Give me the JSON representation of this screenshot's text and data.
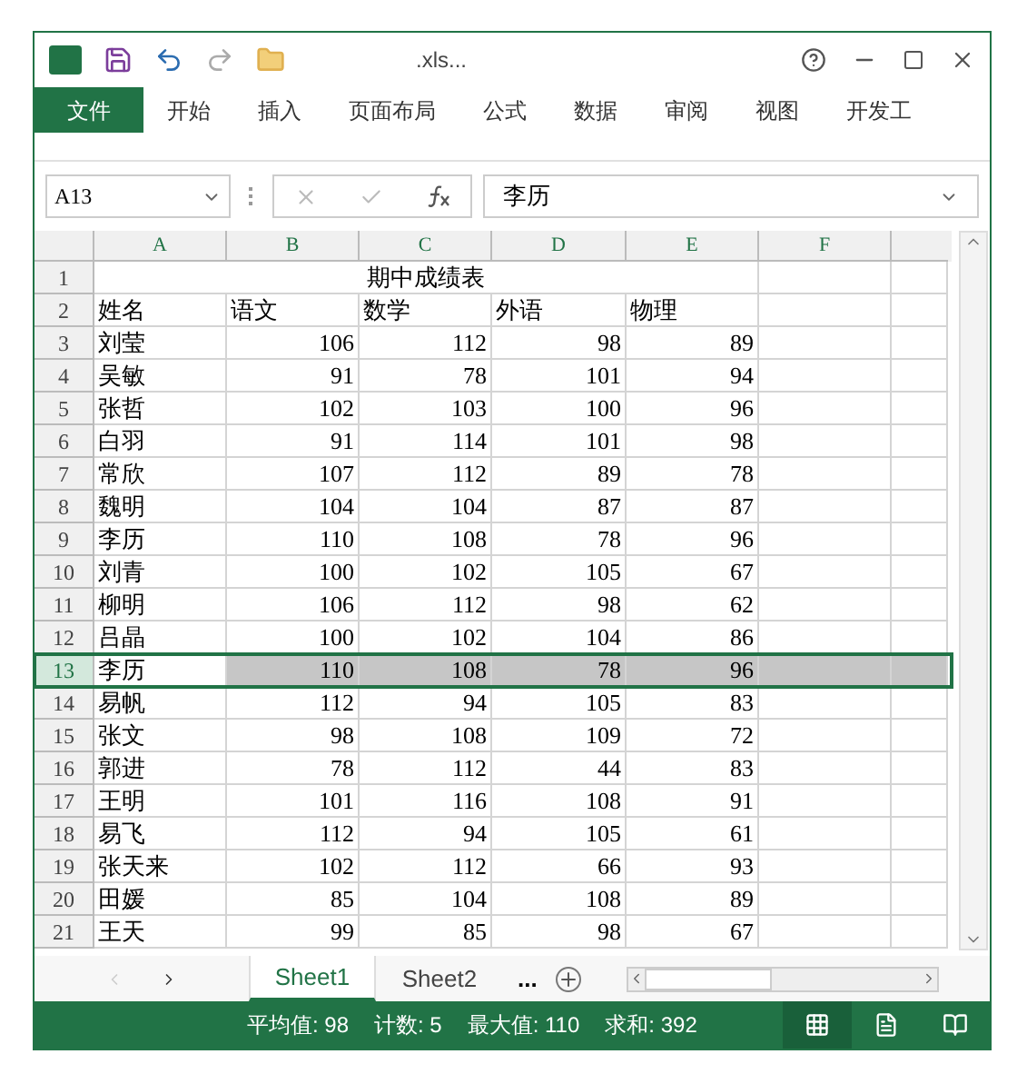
{
  "window": {
    "title": ".xls..."
  },
  "ribbon_tabs": [
    {
      "label": "文件",
      "kind": "file"
    },
    {
      "label": "开始",
      "kind": "tab"
    },
    {
      "label": "插入",
      "kind": "tab"
    },
    {
      "label": "页面布局",
      "kind": "tab"
    },
    {
      "label": "公式",
      "kind": "tab"
    },
    {
      "label": "数据",
      "kind": "tab"
    },
    {
      "label": "审阅",
      "kind": "tab"
    },
    {
      "label": "视图",
      "kind": "tab"
    },
    {
      "label": "开发工",
      "kind": "tab"
    }
  ],
  "formula_bar": {
    "name_box": "A13",
    "value": "李历"
  },
  "sheet": {
    "columns": [
      "A",
      "B",
      "C",
      "D",
      "E",
      "F"
    ],
    "title_row": {
      "number": "1",
      "text": "期中成绩表"
    },
    "rows": [
      {
        "number": "2",
        "kind": "header",
        "selected": false,
        "cells": [
          "姓名",
          "语文",
          "数学",
          "外语",
          "物理"
        ]
      },
      {
        "number": "3",
        "kind": "data",
        "selected": false,
        "cells": [
          "刘莹",
          "106",
          "112",
          "98",
          "89"
        ]
      },
      {
        "number": "4",
        "kind": "data",
        "selected": false,
        "cells": [
          "吴敏",
          "91",
          "78",
          "101",
          "94"
        ]
      },
      {
        "number": "5",
        "kind": "data",
        "selected": false,
        "cells": [
          "张哲",
          "102",
          "103",
          "100",
          "96"
        ]
      },
      {
        "number": "6",
        "kind": "data",
        "selected": false,
        "cells": [
          "白羽",
          "91",
          "114",
          "101",
          "98"
        ]
      },
      {
        "number": "7",
        "kind": "data",
        "selected": false,
        "cells": [
          "常欣",
          "107",
          "112",
          "89",
          "78"
        ]
      },
      {
        "number": "8",
        "kind": "data",
        "selected": false,
        "cells": [
          "魏明",
          "104",
          "104",
          "87",
          "87"
        ]
      },
      {
        "number": "9",
        "kind": "data",
        "selected": false,
        "cells": [
          "李历",
          "110",
          "108",
          "78",
          "96"
        ]
      },
      {
        "number": "10",
        "kind": "data",
        "selected": false,
        "cells": [
          "刘青",
          "100",
          "102",
          "105",
          "67"
        ]
      },
      {
        "number": "11",
        "kind": "data",
        "selected": false,
        "cells": [
          "柳明",
          "106",
          "112",
          "98",
          "62"
        ]
      },
      {
        "number": "12",
        "kind": "data",
        "selected": false,
        "cells": [
          "吕晶",
          "100",
          "102",
          "104",
          "86"
        ]
      },
      {
        "number": "13",
        "kind": "data",
        "selected": true,
        "cells": [
          "李历",
          "110",
          "108",
          "78",
          "96"
        ]
      },
      {
        "number": "14",
        "kind": "data",
        "selected": false,
        "cells": [
          "易帆",
          "112",
          "94",
          "105",
          "83"
        ]
      },
      {
        "number": "15",
        "kind": "data",
        "selected": false,
        "cells": [
          "张文",
          "98",
          "108",
          "109",
          "72"
        ]
      },
      {
        "number": "16",
        "kind": "data",
        "selected": false,
        "cells": [
          "郭进",
          "78",
          "112",
          "44",
          "83"
        ]
      },
      {
        "number": "17",
        "kind": "data",
        "selected": false,
        "cells": [
          "王明",
          "101",
          "116",
          "108",
          "91"
        ]
      },
      {
        "number": "18",
        "kind": "data",
        "selected": false,
        "cells": [
          "易飞",
          "112",
          "94",
          "105",
          "61"
        ]
      },
      {
        "number": "19",
        "kind": "data",
        "selected": false,
        "cells": [
          "张天来",
          "102",
          "112",
          "66",
          "93"
        ]
      },
      {
        "number": "20",
        "kind": "data",
        "selected": false,
        "cells": [
          "田媛",
          "85",
          "104",
          "108",
          "89"
        ]
      },
      {
        "number": "21",
        "kind": "data",
        "selected": false,
        "cells": [
          "王天",
          "99",
          "85",
          "98",
          "67"
        ]
      }
    ]
  },
  "sheet_tabs": [
    {
      "label": "Sheet1",
      "selected": true
    },
    {
      "label": "Sheet2",
      "selected": false
    }
  ],
  "more_sheets": "...",
  "status_bar": {
    "items": [
      "平均值: 98",
      "计数: 5",
      "最大值: 110",
      "求和: 392"
    ],
    "views": [
      {
        "kind": "normal",
        "selected": true
      },
      {
        "kind": "page_layout",
        "selected": false
      },
      {
        "kind": "page_break",
        "selected": false
      }
    ]
  }
}
